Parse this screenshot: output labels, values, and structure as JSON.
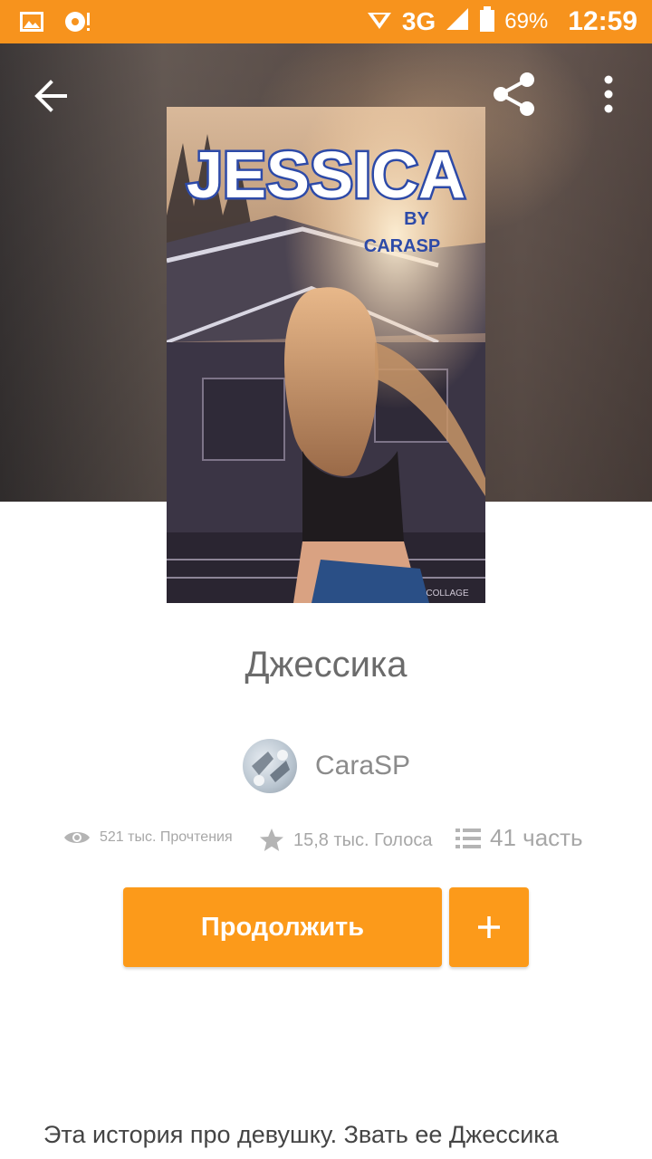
{
  "status_bar": {
    "network": "3G",
    "battery": "69%",
    "time": "12:59",
    "background_color": "#f7931d"
  },
  "cover": {
    "title_text": "JESSICA",
    "byline": "BY",
    "author_text": "CARASP",
    "watermark": "COLLAGE"
  },
  "story": {
    "title": "Джессика",
    "author": "CaraSP",
    "stats": {
      "reads": "521 тыс. Прочтения",
      "votes": "15,8 тыс. Голоса",
      "parts": "41 часть"
    },
    "description": "Эта история про девушку. Звать ее Джессика"
  },
  "actions": {
    "continue_label": "Продолжить",
    "add_label": "+"
  },
  "colors": {
    "accent": "#fc9a1a",
    "title_gray": "#6b6b6b",
    "muted_gray": "#a7a7a7"
  }
}
